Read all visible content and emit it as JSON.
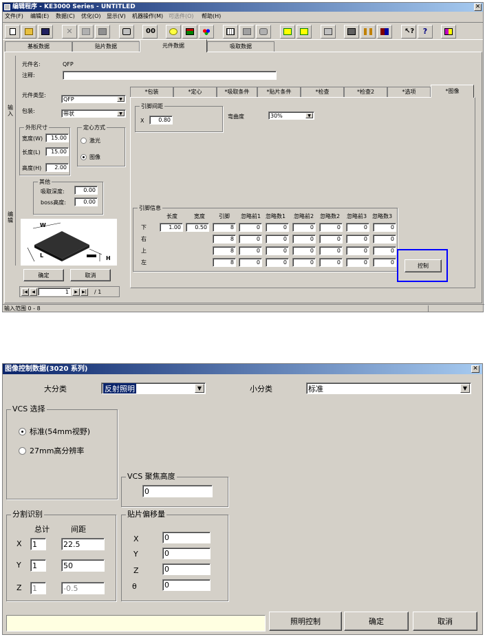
{
  "window1": {
    "title": "编辑程序 - KE3000 Series - UNTITLED",
    "menu": [
      "文件(F)",
      "编辑(E)",
      "数据(C)",
      "优化(O)",
      "显示(V)",
      "机器操作(M)",
      "可选件(O)",
      "帮助(H)"
    ],
    "toolbar_icons": [
      "new-file-icon",
      "open-folder-icon",
      "save-disk-icon",
      "cut-icon",
      "copy-icon",
      "paste-icon",
      "print-icon",
      "binoculars-icon",
      "lightbulb-icon",
      "machine-icon",
      "components-icon",
      "grid-icon",
      "feeder-icon",
      "camera-icon",
      "nozzle-icon",
      "tool-icon",
      "calculator-icon",
      "board-icon",
      "pause-icon",
      "book-icon",
      "help-pointer-icon",
      "help-icon",
      "exit-icon"
    ],
    "main_tabs": [
      "基板数据",
      "贴片数据",
      "元件数据",
      "吸取数据"
    ],
    "active_main_tab": 2,
    "side_labels": [
      "输入",
      "编辑"
    ],
    "part_name_label": "元件名:",
    "part_name": "QFP",
    "comment_label": "注释:",
    "comment": "",
    "part_type_label": "元件类型:",
    "part_type": "QFP",
    "package_label": "包装:",
    "package": "带状",
    "dim_group": "外形尺寸",
    "dims": [
      {
        "label": "宽度(W)",
        "value": "15.00"
      },
      {
        "label": "长度(L)",
        "value": "15.00"
      },
      {
        "label": "高度(H)",
        "value": "2.00"
      }
    ],
    "center_group": "定心方式",
    "center_opts": [
      {
        "label": "激光",
        "checked": false
      },
      {
        "label": "图像",
        "checked": true
      }
    ],
    "other_group": "其他",
    "other": [
      {
        "label": "吸取深度:",
        "value": "0.00"
      },
      {
        "label": "boss高度:",
        "value": "0.00"
      }
    ],
    "ok": "确定",
    "cancel": "取消",
    "nav_page": "1",
    "nav_total": "/ 1",
    "sub_tabs": [
      "*包装",
      "*定心",
      "*吸取条件",
      "*贴片条件",
      "*检查",
      "*检查2",
      "*选项",
      "*图像"
    ],
    "active_sub_tab": 7,
    "pitch_group": "引脚间距",
    "pitch_x_label": "X",
    "pitch_x": "0.80",
    "curve_label": "弯曲度",
    "curve": "30%",
    "lead_group": "引脚信息",
    "lead_headers": [
      "长度",
      "宽度",
      "引脚",
      "忽略前1",
      "忽略数1",
      "忽略前2",
      "忽略数2",
      "忽略前3",
      "忽略数3"
    ],
    "lead_rows": [
      {
        "side": "下",
        "len": "1.00",
        "wid": "0.50",
        "vals": [
          "8",
          "0",
          "0",
          "0",
          "0",
          "0",
          "0"
        ]
      },
      {
        "side": "右",
        "len": "",
        "wid": "",
        "vals": [
          "8",
          "0",
          "0",
          "0",
          "0",
          "0",
          "0"
        ]
      },
      {
        "side": "上",
        "len": "",
        "wid": "",
        "vals": [
          "8",
          "0",
          "0",
          "0",
          "0",
          "0",
          "0"
        ]
      },
      {
        "side": "左",
        "len": "",
        "wid": "",
        "vals": [
          "8",
          "0",
          "0",
          "0",
          "0",
          "0",
          "0"
        ]
      }
    ],
    "control_button": "控制",
    "diagram_labels": {
      "w": "W",
      "l": "L",
      "h": "H"
    },
    "status": "输入范围 0 - 8",
    "highlight_color": "#0000ff"
  },
  "window2": {
    "title": "图像控制数据(3020 系列)",
    "major_label": "大分类",
    "major": "反射照明",
    "minor_label": "小分类",
    "minor": "标准",
    "vcs_group": "VCS 选择",
    "vcs_opts": [
      {
        "label": "标准(54mm视野)",
        "checked": true
      },
      {
        "label": "27mm高分辨率",
        "checked": false
      }
    ],
    "focus_group": "VCS 聚焦高度",
    "focus": "0",
    "split_group": "分割识别",
    "total_label": "总计",
    "spacing_label": "间距",
    "split_rows": [
      {
        "axis": "X",
        "total": "1",
        "spacing": "22.5",
        "disabled": false
      },
      {
        "axis": "Y",
        "total": "1",
        "spacing": "50",
        "disabled": false
      },
      {
        "axis": "Z",
        "total": "1",
        "spacing": "-0.5",
        "disabled": true
      }
    ],
    "offset_group": "贴片偏移量",
    "offsets": [
      {
        "axis": "X",
        "value": "0"
      },
      {
        "axis": "Y",
        "value": "0"
      },
      {
        "axis": "Z",
        "value": "0"
      },
      {
        "axis": "θ",
        "value": "0"
      }
    ],
    "light_button": "照明控制",
    "ok": "确定",
    "cancel": "取消",
    "status_color": "#ffffe1"
  }
}
